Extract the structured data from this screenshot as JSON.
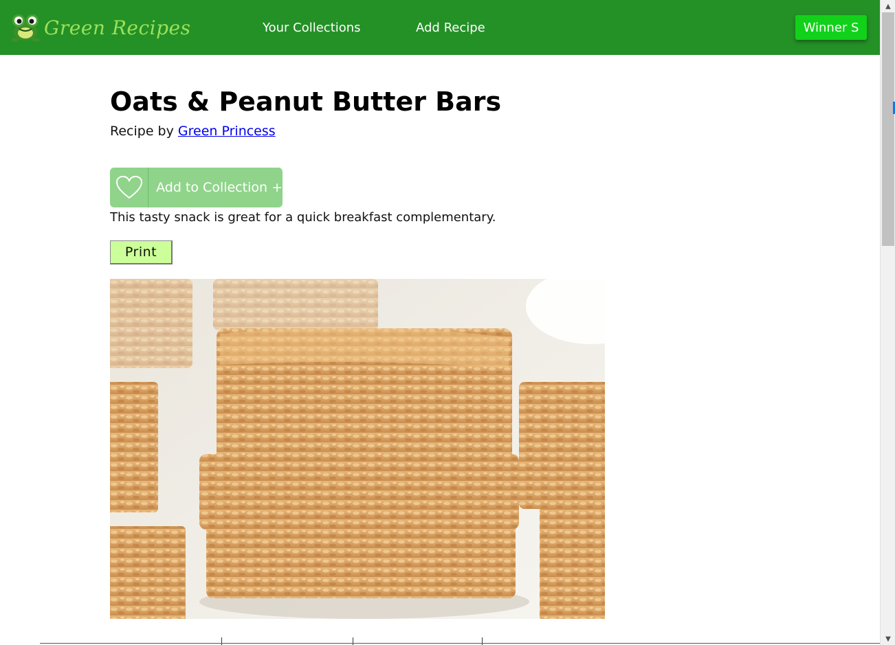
{
  "colors": {
    "navbar": "#249126",
    "logo_text": "#9be15a",
    "user_button": "#12d11a",
    "collection_button": "#8fd48a",
    "print_button": "#ccff99",
    "link": "#0000ee"
  },
  "header": {
    "logo_text": "Green Recipes",
    "logo_icon": "frog-icon",
    "nav": {
      "collections": "Your Collections",
      "add_recipe": "Add Recipe"
    },
    "user_button": "Winner S"
  },
  "recipe": {
    "title": "Oats & Peanut Butter Bars",
    "byline_prefix": "Recipe by",
    "author": "Green Princess",
    "add_to_collection": "Add to Collection +",
    "heart_icon": "heart-icon",
    "description": "This tasty snack is great for a quick breakfast complementary.",
    "print_label": "Print",
    "photo_alt": "Stack of oats and peanut butter bars"
  }
}
